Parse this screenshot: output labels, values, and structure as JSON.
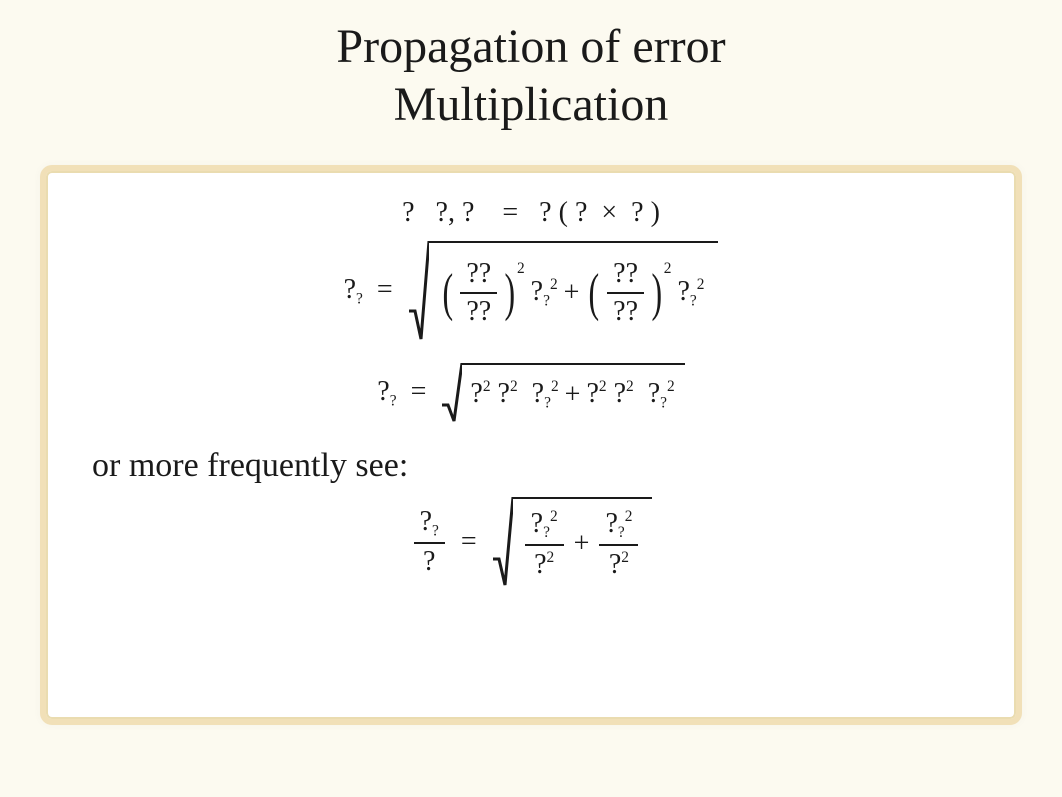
{
  "title_line1": "Propagation of error",
  "title_line2": "Multiplication",
  "caption": "or more frequently see:",
  "sym": {
    "q": "?",
    "qq": "??",
    "two": "2",
    "eq": "=",
    "plus": "+",
    "times": "×",
    "comma": ",",
    "lp": "(",
    "rp": ")"
  }
}
